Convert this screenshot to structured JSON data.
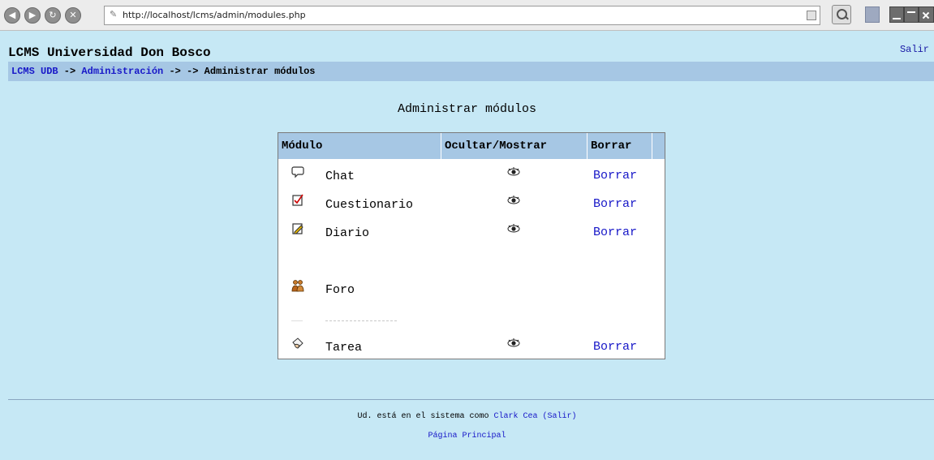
{
  "browser": {
    "url": "http://localhost/lcms/admin/modules.php"
  },
  "header": {
    "site_title": "LCMS Universidad Don Bosco",
    "logout_label": "Salir"
  },
  "breadcrumb": {
    "home": "LCMS UDB",
    "sep1": " -> ",
    "admin": "Administración",
    "sep2": " -> -> ",
    "current": "Administrar módulos"
  },
  "main": {
    "heading": "Administrar módulos",
    "columns": {
      "module": "Módulo",
      "toggle": "Ocultar/Mostrar",
      "delete": "Borrar"
    },
    "rows": [
      {
        "icon": "chat-bubble-icon",
        "name": "Chat",
        "visible_icon": "eye-icon",
        "delete": "Borrar"
      },
      {
        "icon": "quiz-checkbox-icon",
        "name": "Cuestionario",
        "visible_icon": "eye-icon",
        "delete": "Borrar"
      },
      {
        "icon": "journal-pencil-icon",
        "name": "Diario",
        "visible_icon": "eye-icon",
        "delete": "Borrar"
      },
      {
        "icon": "forum-people-icon",
        "name": "Foro"
      },
      {
        "icon": "assignment-hand-icon",
        "name": "Tarea",
        "visible_icon": "eye-icon",
        "delete": "Borrar"
      }
    ]
  },
  "footer": {
    "logged_as": "Ud. está en el sistema como",
    "user": "Clark Cea",
    "logout": "(Salir)",
    "home_link": "Página Principal"
  },
  "colors": {
    "page_bg": "#c6e8f5",
    "bar_bg": "#a6c7e4",
    "link": "#1818c8"
  }
}
